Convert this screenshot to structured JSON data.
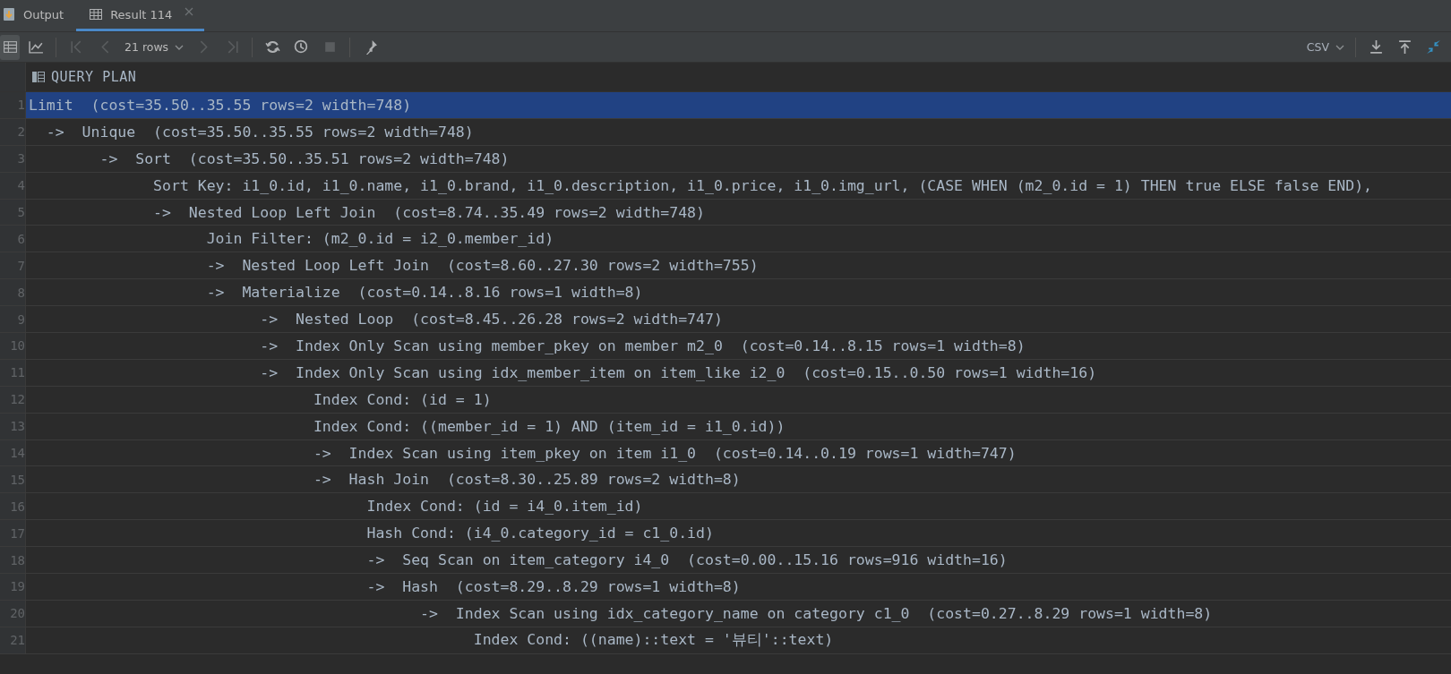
{
  "tabs": [
    {
      "kind": "output",
      "label": "Output",
      "selected": false,
      "closable": false
    },
    {
      "kind": "table",
      "label": "Result 114",
      "selected": true,
      "closable": true
    }
  ],
  "toolbar": {
    "left": [
      {
        "kind": "grid",
        "selected": true,
        "disabled": false
      },
      {
        "kind": "chart",
        "selected": false,
        "disabled": false
      },
      {
        "kind": "sep"
      },
      {
        "kind": "first",
        "selected": false,
        "disabled": true
      },
      {
        "kind": "prev",
        "selected": false,
        "disabled": true
      },
      {
        "kind": "rows",
        "label": "21 rows"
      },
      {
        "kind": "next",
        "selected": false,
        "disabled": true
      },
      {
        "kind": "last",
        "selected": false,
        "disabled": true
      },
      {
        "kind": "sep"
      },
      {
        "kind": "refresh",
        "selected": false,
        "disabled": false
      },
      {
        "kind": "history",
        "selected": false,
        "disabled": false
      },
      {
        "kind": "stop",
        "selected": false,
        "disabled": true
      },
      {
        "kind": "sep"
      },
      {
        "kind": "pin",
        "selected": false,
        "disabled": false
      }
    ],
    "right": [
      {
        "kind": "format",
        "label": "CSV"
      },
      {
        "kind": "sep"
      },
      {
        "kind": "download"
      },
      {
        "kind": "upload"
      },
      {
        "kind": "compare"
      }
    ]
  },
  "table": {
    "columns": [
      "QUERY PLAN"
    ],
    "rows": [
      {
        "line": "1",
        "text": "Limit  (cost=35.50..35.55 rows=2 width=748)",
        "selected": true
      },
      {
        "line": "2",
        "text": "  ->  Unique  (cost=35.50..35.55 rows=2 width=748)",
        "selected": false
      },
      {
        "line": "3",
        "text": "        ->  Sort  (cost=35.50..35.51 rows=2 width=748)",
        "selected": false
      },
      {
        "line": "4",
        "text": "              Sort Key: i1_0.id, i1_0.name, i1_0.brand, i1_0.description, i1_0.price, i1_0.img_url, (CASE WHEN (m2_0.id = 1) THEN true ELSE false END),",
        "selected": false
      },
      {
        "line": "5",
        "text": "              ->  Nested Loop Left Join  (cost=8.74..35.49 rows=2 width=748)",
        "selected": false
      },
      {
        "line": "6",
        "text": "                    Join Filter: (m2_0.id = i2_0.member_id)",
        "selected": false
      },
      {
        "line": "7",
        "text": "                    ->  Nested Loop Left Join  (cost=8.60..27.30 rows=2 width=755)",
        "selected": false
      },
      {
        "line": "8",
        "text": "                    ->  Materialize  (cost=0.14..8.16 rows=1 width=8)",
        "selected": false
      },
      {
        "line": "9",
        "text": "                          ->  Nested Loop  (cost=8.45..26.28 rows=2 width=747)",
        "selected": false
      },
      {
        "line": "10",
        "text": "                          ->  Index Only Scan using member_pkey on member m2_0  (cost=0.14..8.15 rows=1 width=8)",
        "selected": false
      },
      {
        "line": "11",
        "text": "                          ->  Index Only Scan using idx_member_item on item_like i2_0  (cost=0.15..0.50 rows=1 width=16)",
        "selected": false
      },
      {
        "line": "12",
        "text": "                                Index Cond: (id = 1)",
        "selected": false
      },
      {
        "line": "13",
        "text": "                                Index Cond: ((member_id = 1) AND (item_id = i1_0.id))",
        "selected": false
      },
      {
        "line": "14",
        "text": "                                ->  Index Scan using item_pkey on item i1_0  (cost=0.14..0.19 rows=1 width=747)",
        "selected": false
      },
      {
        "line": "15",
        "text": "                                ->  Hash Join  (cost=8.30..25.89 rows=2 width=8)",
        "selected": false
      },
      {
        "line": "16",
        "text": "                                      Index Cond: (id = i4_0.item_id)",
        "selected": false
      },
      {
        "line": "17",
        "text": "                                      Hash Cond: (i4_0.category_id = c1_0.id)",
        "selected": false
      },
      {
        "line": "18",
        "text": "                                      ->  Seq Scan on item_category i4_0  (cost=0.00..15.16 rows=916 width=16)",
        "selected": false
      },
      {
        "line": "19",
        "text": "                                      ->  Hash  (cost=8.29..8.29 rows=1 width=8)",
        "selected": false
      },
      {
        "line": "20",
        "text": "                                            ->  Index Scan using idx_category_name on category c1_0  (cost=0.27..8.29 rows=1 width=8)",
        "selected": false
      },
      {
        "line": "21",
        "text": "                                                  Index Cond: ((name)::text = '뷰티'::text)",
        "selected": false
      }
    ]
  }
}
